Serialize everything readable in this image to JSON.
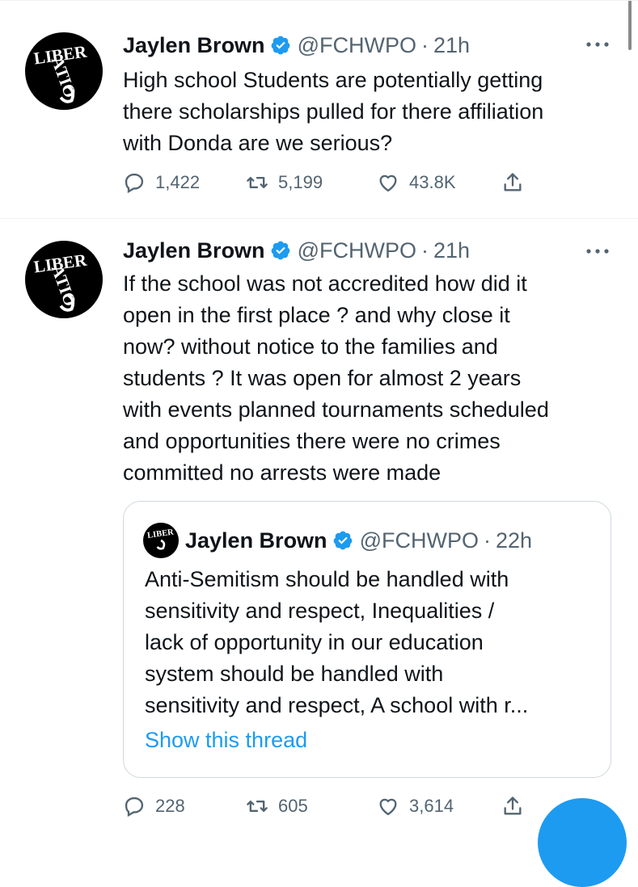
{
  "tweets": [
    {
      "author": {
        "name": "Jaylen Brown",
        "handle": "@FCHWPO",
        "time": "21h",
        "separator": "·"
      },
      "lines": [
        "High school Students are potentially getting",
        "there scholarships pulled for there affiliation",
        "with Donda are we serious?"
      ],
      "stats": {
        "replies": "1,422",
        "retweets": "5,199",
        "likes": "43.8K"
      }
    },
    {
      "author": {
        "name": "Jaylen Brown",
        "handle": "@FCHWPO",
        "time": "21h",
        "separator": "·"
      },
      "lines": [
        "If the school was not accredited how did it",
        "open in the first place ? and why close it",
        "now? without notice to the families and",
        "students ? It was open for almost 2 years",
        "with events planned tournaments scheduled",
        "and opportunities there were no crimes",
        "committed no arrests were made"
      ],
      "quote": {
        "author": {
          "name": "Jaylen Brown",
          "handle": "@FCHWPO",
          "time": "22h",
          "separator": "·"
        },
        "lines": [
          "Anti-Semitism should be handled with",
          "sensitivity and respect, Inequalities /",
          "lack of opportunity in our education",
          "system should be handled with",
          "sensitivity and respect, A school with r..."
        ],
        "show_thread": "Show this thread"
      },
      "stats": {
        "replies": "228",
        "retweets": "605",
        "likes": "3,614"
      }
    }
  ],
  "icons": {
    "verified": "verified-badge-icon",
    "more": "more-options-icon",
    "reply": "reply-icon",
    "retweet": "retweet-icon",
    "like": "heart-icon",
    "share": "share-icon"
  },
  "avatar_lettering": "LIBERATION",
  "colors": {
    "accent": "#1d9bf0",
    "secondary_text": "#536471",
    "text": "#0f1419",
    "border": "#cfd9de"
  }
}
